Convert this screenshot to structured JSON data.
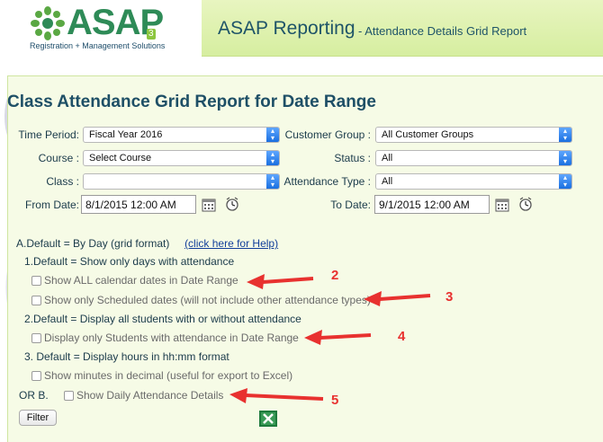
{
  "header": {
    "logo_text": "ASAP",
    "logo_tagline": "Registration + Management Solutions",
    "app_title": "ASAP Reporting",
    "app_subtitle": "- Attendance Details Grid Report"
  },
  "report": {
    "title": "Class Attendance Grid Report for Date Range"
  },
  "form": {
    "time_period": {
      "label": "Time Period:",
      "value": "Fiscal Year 2016"
    },
    "customer_group": {
      "label": "Customer Group :",
      "value": "All Customer Groups"
    },
    "course": {
      "label": "Course :",
      "value": "Select Course"
    },
    "status": {
      "label": "Status :",
      "value": "All"
    },
    "class": {
      "label": "Class :",
      "value": ""
    },
    "attendance_type": {
      "label": "Attendance Type :",
      "value": "All"
    },
    "from_date": {
      "label": "From Date:",
      "value": "8/1/2015 12:00 AM"
    },
    "to_date": {
      "label": "To Date:",
      "value": "9/1/2015 12:00 AM"
    }
  },
  "options": {
    "a_default": "A.Default = By Day (grid format)",
    "help_link": "(click here for Help)",
    "one_default": "1.Default = Show only days with attendance",
    "show_all_calendar": "Show ALL calendar dates in Date Range",
    "show_scheduled": "Show only Scheduled dates (will not include other attendance types)",
    "two_default": "2.Default = Display all students with or without attendance",
    "display_students": "Display only Students with attendance in Date Range",
    "three_default": "3. Default = Display hours in hh:mm format",
    "show_minutes": "Show minutes in decimal (useful for export to Excel)",
    "or_b": "OR B.",
    "show_daily": "Show Daily Attendance Details"
  },
  "buttons": {
    "filter": "Filter"
  },
  "annotations": [
    "2",
    "3",
    "4",
    "5"
  ],
  "colors": {
    "header_band": "#d6eea0",
    "panel_bg": "#f6fbe6",
    "title_color": "#1e4f66",
    "annotation_red": "#e8312f",
    "select_arrow": "#1a6fe0"
  }
}
